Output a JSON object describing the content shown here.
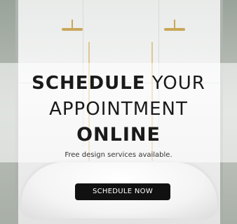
{
  "ad": {
    "headline": {
      "line1_bold": "SCHEDULE",
      "line1_light": "YOUR",
      "line2": "APPOINTMENT",
      "line3": "ONLINE"
    },
    "subtext": "Free design services available.",
    "cta_label": "SCHEDULE NOW"
  },
  "colors": {
    "text": "#1a1a1a",
    "button_bg": "#111111",
    "button_text": "#ffffff",
    "fixture_gold": "#c9a75a"
  }
}
